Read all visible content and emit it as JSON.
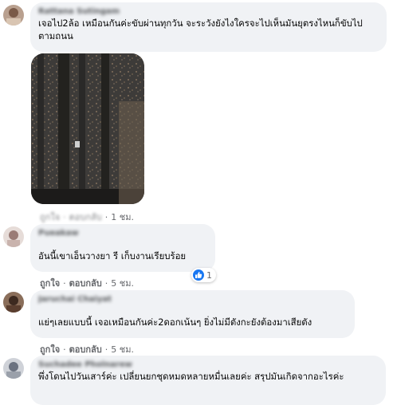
{
  "comments": [
    {
      "author": "Rattana Sutingam",
      "text": "เจอไป2ล้อ เหมือนกันค่ะขับผ่านทุกวัน จะระวังยังไงใครจะไปเห็นมันยุตรงไหนก็ขับไปตามถนน",
      "like": "ถูกใจ",
      "reply": "ตอบกลับ",
      "time": "1 ชม."
    },
    {
      "author": "Pueakaw",
      "text": "อันนี้เขาเอ็นวางยา รี เก็บงานเรียบร้อย",
      "like": "ถูกใจ",
      "reply": "ตอบกลับ",
      "time": "5 ชม.",
      "reaction_count": "1"
    },
    {
      "author": "Jaruchai Chaiyat",
      "text": "แย่ๆเลยแบบนี้ เจอเหมือนกันค่ะ2ดอกเน้นๆ ยิ่งไม่มีตังกะยังต้องมาเสียตัง",
      "like": "ถูกใจ",
      "reply": "ตอบกลับ",
      "time": "5 ชม."
    },
    {
      "author": "Suchadee Pholnarew",
      "text": "พึ่งโดนไปวันเสาร์ค่ะ เปลี่ยนยกชุดหมดหลายหมื่นเลยค่ะ สรุปมันเกิดจากอะไรค่ะ"
    }
  ],
  "colors": {
    "bubble": "#f0f2f5",
    "meta": "#65676b",
    "like_blue": "#1877f2"
  },
  "icons": [
    "like-icon"
  ]
}
